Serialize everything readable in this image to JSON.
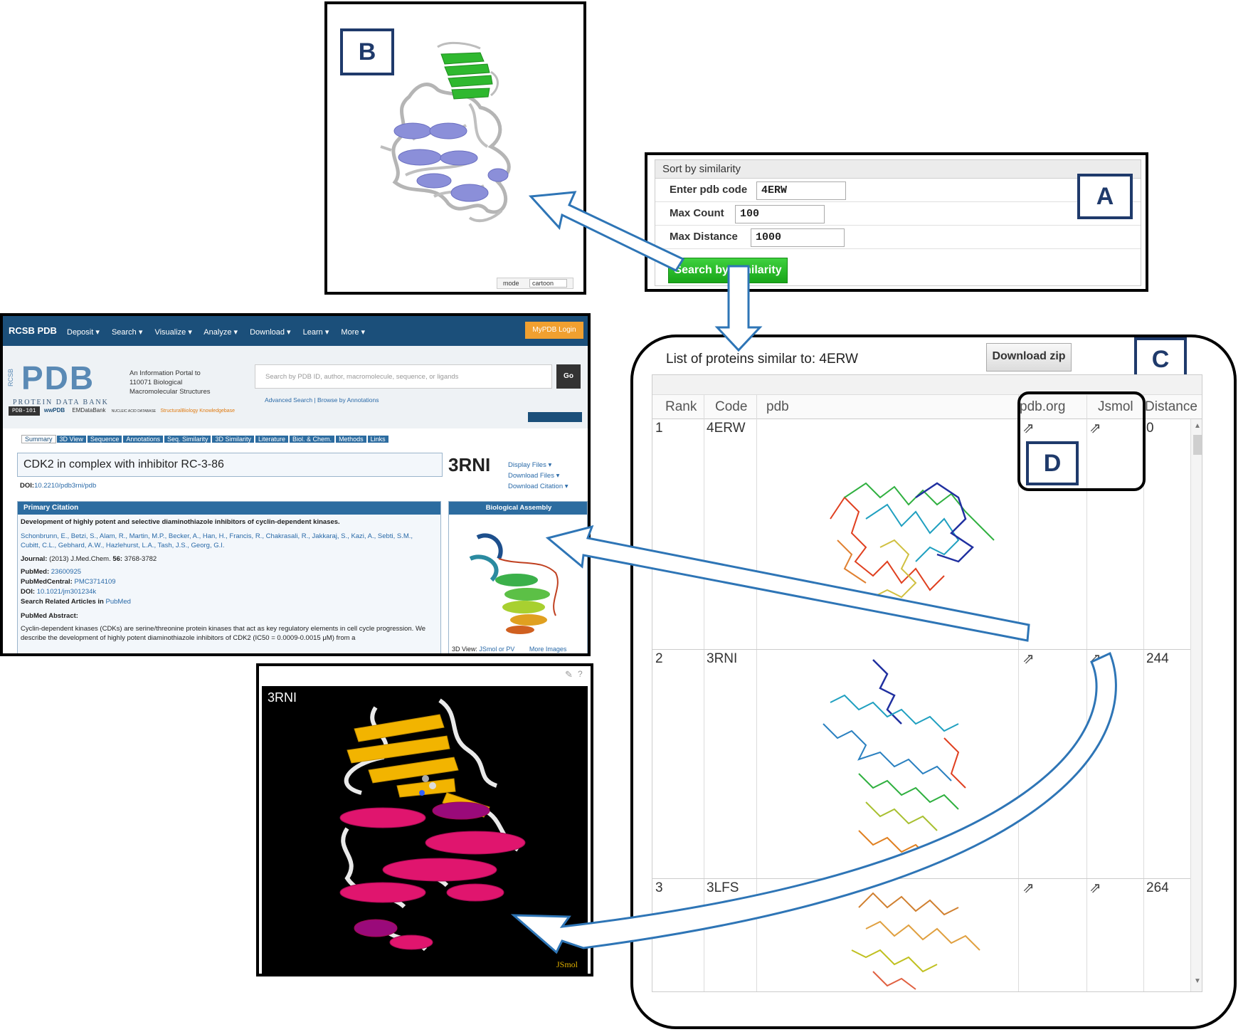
{
  "labels": {
    "a": "A",
    "b": "B",
    "c": "C",
    "d": "D"
  },
  "panel_a": {
    "header": "Sort by similarity",
    "fields": [
      {
        "label": "Enter pdb code",
        "value": "4ERW"
      },
      {
        "label": "Max Count",
        "value": "100"
      },
      {
        "label": "Max Distance",
        "value": "1000"
      }
    ],
    "button": "Search by similarity"
  },
  "panel_b": {
    "mode_label": "mode",
    "mode_value": "cartoon"
  },
  "panel_c": {
    "title": "List of proteins similar to: 4ERW",
    "download_button": "Download zip",
    "columns": [
      "Rank",
      "Code",
      "pdb",
      "pdb.org",
      "Jsmol",
      "Distance"
    ],
    "rows": [
      {
        "rank": "1",
        "code": "4ERW",
        "distance": "0"
      },
      {
        "rank": "2",
        "code": "3RNI",
        "distance": "244"
      },
      {
        "rank": "3",
        "code": "3LFS",
        "distance": "264"
      }
    ]
  },
  "pdb_page": {
    "brand": "RCSB PDB",
    "nav": [
      "Deposit ▾",
      "Search ▾",
      "Visualize ▾",
      "Analyze ▾",
      "Download ▾",
      "Learn ▾",
      "More ▾"
    ],
    "login": "MyPDB Login",
    "logo": "PDB",
    "logo_sub": "PROTEIN DATA BANK",
    "tagline": "An Information Portal to 110071 Biological Macromolecular Structures",
    "search_placeholder": "Search by PDB ID, author, macromolecule, sequence, or ligands",
    "go": "Go",
    "advanced": "Advanced Search | Browse by Annotations",
    "partner_links": [
      "PDB-101",
      "wwPDB",
      "EMDataBank",
      "NUCLEIC ACID DATABASE",
      "StructuralBiology Knowledgebase"
    ],
    "tabs": [
      "Summary",
      "3D View",
      "Sequence",
      "Annotations",
      "Seq. Similarity",
      "3D Similarity",
      "Literature",
      "Biol. & Chem.",
      "Methods",
      "Links"
    ],
    "structure_title": "CDK2 in complex with inhibitor RC-3-86",
    "pdb_id": "3RNI",
    "doi": "DOI:",
    "doi_value": "10.2210/pdb3rni/pdb",
    "files": [
      "Display Files ▾",
      "Download Files ▾",
      "Download Citation ▾"
    ],
    "primary_citation": "Primary Citation",
    "citation_title": "Development of highly potent and selective diaminothiazole inhibitors of cyclin-dependent kinases.",
    "authors": "Schonbrunn, E., Betzi, S., Alam, R., Martin, M.P., Becker, A., Han, H., Francis, R., Chakrasali, R., Jakkaraj, S., Kazi, A., Sebti, S.M., Cubitt, C.L., Gebhard, A.W., Hazlehurst, L.A., Tash, J.S., Georg, G.I.",
    "journal_label": "Journal:",
    "journal": "(2013) J.Med.Chem.",
    "journal_vol": "56:",
    "journal_pages": "3768-3782",
    "pubmed_label": "PubMed:",
    "pubmed": "23600925",
    "pmc_label": "PubMedCentral:",
    "pmc": "PMC3714109",
    "doi2_label": "DOI:",
    "doi2": "10.1021/jm301234k",
    "related_label": "Search Related Articles in",
    "related": "PubMed",
    "abstract_label": "PubMed Abstract:",
    "abstract": "Cyclin-dependent kinases (CDKs) are serine/threonine protein kinases that act as key regulatory elements in cell cycle progression. We describe the development of highly potent diaminothiazole inhibitors of CDK2 (IC50 = 0.0009-0.0015 μM) from a",
    "bio_assembly": "Biological Assembly",
    "view_3d": "3D View:",
    "view_links": "JSmol or PV",
    "more_images": "More Images"
  },
  "jsmol": {
    "title": "3RNI",
    "brand": "JSmol"
  },
  "colors": {
    "label_blue": "#1f3a6b",
    "arrow_blue": "#2e75b6",
    "green_button": "#22b322",
    "pdb_nav": "#1b4f7a"
  }
}
